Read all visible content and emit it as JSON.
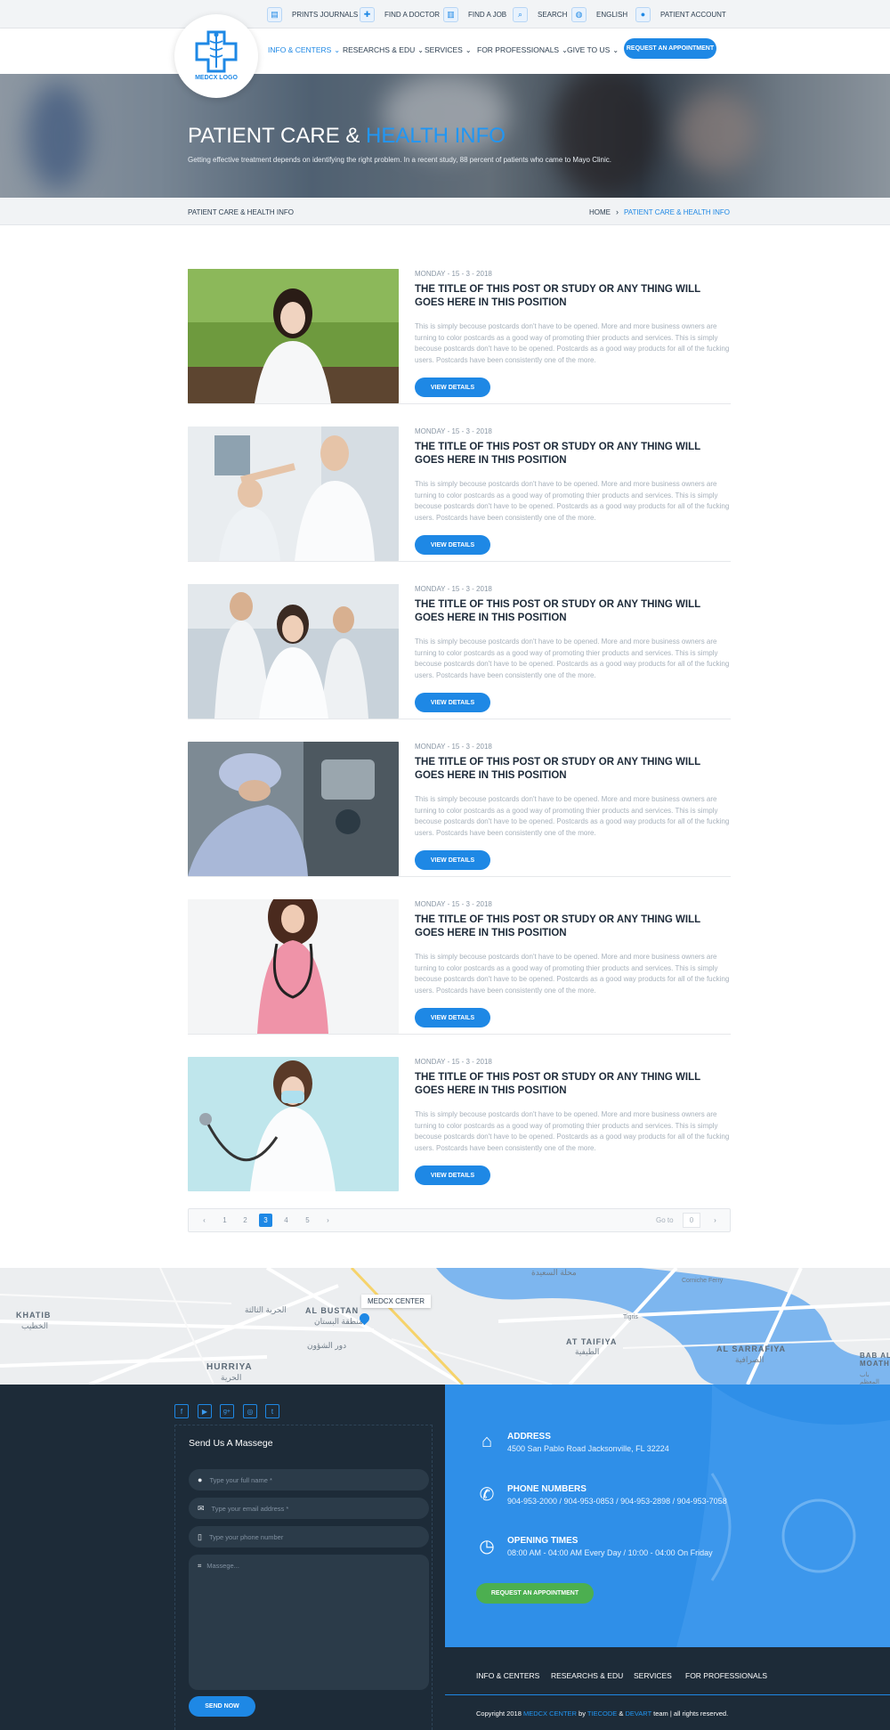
{
  "topbar": {
    "items": [
      {
        "label": "PRINTS JOURNALS",
        "icon": "journal-icon"
      },
      {
        "label": "FIND A DOCTOR",
        "icon": "doctor-icon"
      },
      {
        "label": "FIND A JOB",
        "icon": "job-icon"
      },
      {
        "label": "SEARCH",
        "icon": "search-icon"
      },
      {
        "label": "ENGLISH",
        "icon": "globe-icon"
      },
      {
        "label": "PATIENT ACCOUNT",
        "icon": "user-icon"
      }
    ]
  },
  "nav": {
    "logo_text": "MEDCX LOGO",
    "items": [
      "INFO & CENTERS",
      "RESEARCHS & EDU",
      "SERVICES",
      "FOR PROFESSIONALS",
      "GIVE TO US"
    ],
    "active_index": 0,
    "cta": "REQUEST AN APPOINTMENT"
  },
  "hero": {
    "title_part1": "PATIENT CARE & ",
    "title_part2": "HEALTH INFO",
    "subtitle": "Getting effective treatment depends on identifying the right problem. In a recent study, 88 percent of patients who came to Mayo Clinic."
  },
  "breadcrumb": {
    "page": "PATIENT CARE & HEALTH INFO",
    "home": "HOME",
    "current": "PATIENT CARE & HEALTH INFO"
  },
  "posts": [
    {
      "date": "MONDAY - 15 - 3 - 2018",
      "title": "THE TITLE OF THIS POST OR STUDY OR ANY THING WILL GOES HERE IN THIS POSITION",
      "body": "This is simply becouse postcards don't have to be opened. More and more business owners are turning to color postcards as a good way of promoting thier products and services. This is simply becouse postcards don't have to be opened. Postcards as a good way products for all of the fucking users. Postcards have been consistently one of the more.",
      "button": "VIEW DETAILS"
    },
    {
      "date": "MONDAY - 15 - 3 - 2018",
      "title": "THE TITLE OF THIS POST OR STUDY OR ANY THING WILL GOES HERE IN THIS POSITION",
      "body": "This is simply becouse postcards don't have to be opened. More and more business owners are turning to color postcards as a good way of promoting thier products and services. This is simply becouse postcards don't have to be opened. Postcards as a good way products for all of the fucking users. Postcards have been consistently one of the more.",
      "button": "VIEW DETAILS"
    },
    {
      "date": "MONDAY - 15 - 3 - 2018",
      "title": "THE TITLE OF THIS POST OR STUDY OR ANY THING WILL GOES HERE IN THIS POSITION",
      "body": "This is simply becouse postcards don't have to be opened. More and more business owners are turning to color postcards as a good way of promoting thier products and services. This is simply becouse postcards don't have to be opened. Postcards as a good way products for all of the fucking users. Postcards have been consistently one of the more.",
      "button": "VIEW DETAILS"
    },
    {
      "date": "MONDAY - 15 - 3 - 2018",
      "title": "THE TITLE OF THIS POST OR STUDY OR ANY THING WILL GOES HERE IN THIS POSITION",
      "body": "This is simply becouse postcards don't have to be opened. More and more business owners are turning to color postcards as a good way of promoting thier products and services. This is simply becouse postcards don't have to be opened. Postcards as a good way products for all of the fucking users. Postcards have been consistently one of the more.",
      "button": "VIEW DETAILS"
    },
    {
      "date": "MONDAY - 15 - 3 - 2018",
      "title": "THE TITLE OF THIS POST OR STUDY OR ANY THING WILL GOES HERE IN THIS POSITION",
      "body": "This is simply becouse postcards don't have to be opened. More and more business owners are turning to color postcards as a good way of promoting thier products and services. This is simply becouse postcards don't have to be opened. Postcards as a good way products for all of the fucking users. Postcards have been consistently one of the more.",
      "button": "VIEW DETAILS"
    },
    {
      "date": "MONDAY - 15 - 3 - 2018",
      "title": "THE TITLE OF THIS POST OR STUDY OR ANY THING WILL GOES HERE IN THIS POSITION",
      "body": "This is simply becouse postcards don't have to be opened. More and more business owners are turning to color postcards as a good way of promoting thier products and services. This is simply becouse postcards don't have to be opened. Postcards as a good way products for all of the fucking users. Postcards have been consistently one of the more.",
      "button": "VIEW DETAILS"
    }
  ],
  "pagination": {
    "prev": "‹",
    "next": "›",
    "pages": [
      "1",
      "2",
      "3",
      "4",
      "5"
    ],
    "active": "3",
    "goto_label": "Go to",
    "goto_value": "0",
    "goto_next": "›"
  },
  "map": {
    "marker_label": "MEDCX CENTER",
    "labels": [
      "KHATIB",
      "AL BUSTAN",
      "HURRIYA",
      "AT TAIFIYA",
      "AL SARRAFIYA",
      "BAB AL MOATHAM",
      "Tigris",
      "Corniche Ferry"
    ],
    "arabic_labels": [
      "الخطيب",
      "الحرية الثالثة",
      "منطقة البستان",
      "دور الشؤون",
      "الحرية",
      "محلة السعيدة",
      "الطيفية",
      "الصرافية",
      "باب المعظم"
    ]
  },
  "contact_form": {
    "social": [
      "f",
      "▶",
      "g+",
      "◎",
      "t"
    ],
    "title": "Send Us A Massege",
    "name_placeholder": "Type your full name *",
    "email_placeholder": "Type your email address *",
    "phone_placeholder": "Type your phone number",
    "message_placeholder": "Massege...",
    "send": "SEND NOW"
  },
  "contact_info": {
    "address_label": "ADDRESS",
    "address": "4500 San Pablo Road Jacksonville, FL 32224",
    "phone_label": "PHONE NUMBERS",
    "phones": "904-953-2000 / 904-953-0853 / 904-953-2898 / 904-953-7058",
    "hours_label": "OPENING TIMES",
    "hours": "08:00 AM - 04:00 AM Every Day / 10:00 - 04:00 On Friday",
    "cta": "REQUEST AN APPOINTMENT"
  },
  "footer": {
    "nav": [
      "INFO & CENTERS",
      "RESEARCHS & EDU",
      "SERVICES",
      "FOR PROFESSIONALS"
    ],
    "copy_prefix": "Copyright 2018 ",
    "copy_brand": "MEDCX CENTER",
    "copy_by": " by ",
    "copy_team1": "TIECODE",
    "copy_amp": " & ",
    "copy_team2": "DEVART",
    "copy_suffix": " team | all rights reserved."
  },
  "colors": {
    "accent": "#1e88e5",
    "dark": "#1d2b38",
    "green": "#4caf50",
    "blue_panel": "#2f8fe8"
  }
}
